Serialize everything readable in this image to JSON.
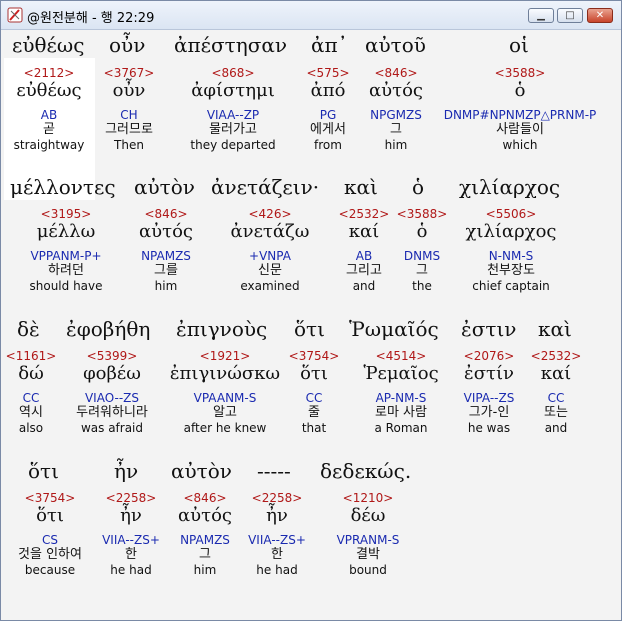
{
  "window": {
    "title": "@원전분해 - 행 22:29"
  },
  "rows": [
    {
      "greek_text": [
        "εὐθέως",
        "οὖν",
        "ἀπέστησαν",
        "ἀπ᾽",
        "αὐτοῦ",
        "οἱ"
      ],
      "words": [
        {
          "strong": "<2112>",
          "lemma": "εὐθέως",
          "parse": "AB",
          "korean": "곧",
          "english": "straightway"
        },
        {
          "strong": "<3767>",
          "lemma": "οὖν",
          "parse": "CH",
          "korean": "그러므로",
          "english": "Then"
        },
        {
          "strong": "<868>",
          "lemma": "ἀφίστημι",
          "parse": "VIAA--ZP",
          "korean": "물러가고",
          "english": "they departed"
        },
        {
          "strong": "<575>",
          "lemma": "ἀπό",
          "parse": "PG",
          "korean": "에게서",
          "english": "from"
        },
        {
          "strong": "<846>",
          "lemma": "αὐτός",
          "parse": "NPGMZS",
          "korean": "그",
          "english": "him"
        },
        {
          "strong": "<3588>",
          "lemma": "ὁ",
          "parse": "DNMP#NPNMZP△PRNM-P",
          "korean": "사람들이",
          "english": "which"
        }
      ]
    },
    {
      "greek_text": [
        "μέλλοντες",
        "αὐτὸν",
        "ἀνετάζειν·",
        "καὶ",
        "ὁ",
        "χιλίαρχος"
      ],
      "words": [
        {
          "strong": "<3195>",
          "lemma": "μέλλω",
          "parse": "VPPANM-P+",
          "korean": "하려던",
          "english": "should have"
        },
        {
          "strong": "<846>",
          "lemma": "αὐτός",
          "parse": "NPAMZS",
          "korean": "그를",
          "english": "him"
        },
        {
          "strong": "<426>",
          "lemma": "ἀνετάζω",
          "parse": "+VNPA",
          "korean": "신문",
          "english": "examined"
        },
        {
          "strong": "<2532>",
          "lemma": "καί",
          "parse": "AB",
          "korean": "그리고",
          "english": "and"
        },
        {
          "strong": "<3588>",
          "lemma": "ὁ",
          "parse": "DNMS",
          "korean": "그",
          "english": "the"
        },
        {
          "strong": "<5506>",
          "lemma": "χιλίαρχος",
          "parse": "N-NM-S",
          "korean": "천부장도",
          "english": "chief captain"
        }
      ]
    },
    {
      "greek_text": [
        "δὲ",
        "ἐφοβήθη",
        "ἐπιγνοὺς",
        "ὅτι",
        "Ῥωμαῖός",
        "ἐστιν",
        "καὶ"
      ],
      "words": [
        {
          "strong": "<1161>",
          "lemma": "δώ",
          "parse": "CC",
          "korean": "역시",
          "english": "also"
        },
        {
          "strong": "<5399>",
          "lemma": "φοβέω",
          "parse": "VIAO--ZS",
          "korean": "두려워하니라",
          "english": "was afraid"
        },
        {
          "strong": "<1921>",
          "lemma": "ἐπιγινώσκω",
          "parse": "VPAANM-S",
          "korean": "알고",
          "english": "after he knew"
        },
        {
          "strong": "<3754>",
          "lemma": "ὅτι",
          "parse": "CC",
          "korean": "줄",
          "english": "that"
        },
        {
          "strong": "<4514>",
          "lemma": "Ῥεμαῖος",
          "parse": "AP-NM-S",
          "korean": "로마 사람",
          "english": "a Roman"
        },
        {
          "strong": "<2076>",
          "lemma": "ἐστίν",
          "parse": "VIPA--ZS",
          "korean": "그가-인",
          "english": "he was"
        },
        {
          "strong": "<2532>",
          "lemma": "καί",
          "parse": "CC",
          "korean": "또는",
          "english": "and"
        }
      ]
    },
    {
      "greek_text": [
        "ὅτι",
        "ἦν",
        "αὐτὸν",
        "-----",
        "δεδεκώς."
      ],
      "words": [
        {
          "strong": "<3754>",
          "lemma": "ὅτι",
          "parse": "CS",
          "korean": "것을 인하여",
          "english": "because"
        },
        {
          "strong": "<2258>",
          "lemma": "ἦν",
          "parse": "VIIA--ZS+",
          "korean": "한",
          "english": "he had"
        },
        {
          "strong": "<846>",
          "lemma": "αὐτός",
          "parse": "NPAMZS",
          "korean": "그",
          "english": "him"
        },
        {
          "strong": "<2258>",
          "lemma": "ἦν",
          "parse": "VIIA--ZS+",
          "korean": "한",
          "english": "he had"
        },
        {
          "strong": "<1210>",
          "lemma": "δέω",
          "parse": "VPRANM-S",
          "korean": "결박",
          "english": "bound"
        }
      ]
    }
  ]
}
